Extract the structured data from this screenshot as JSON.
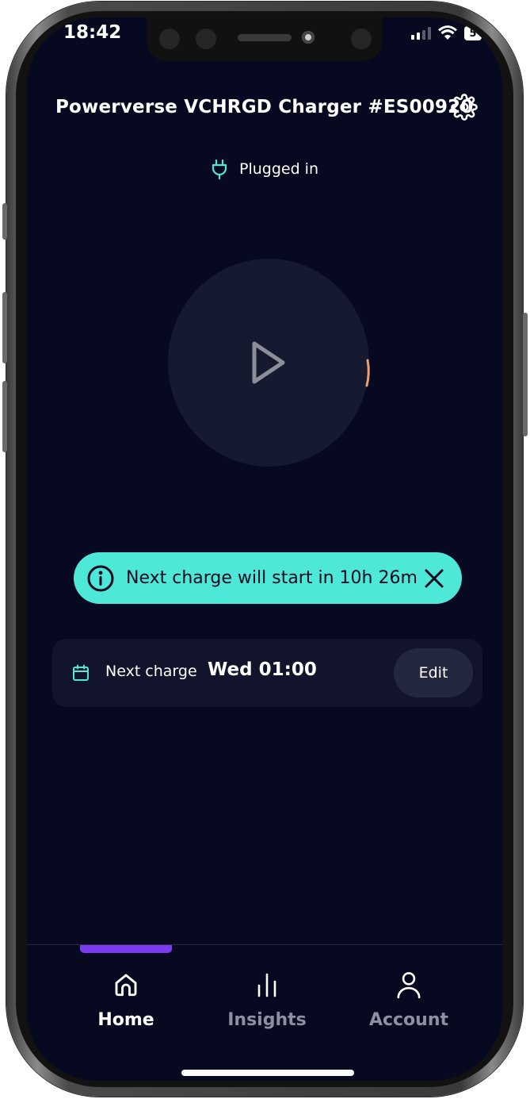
{
  "status_bar": {
    "time": "18:42",
    "battery": "5",
    "icons": [
      "signal-icon",
      "wifi-icon",
      "battery-icon"
    ]
  },
  "header": {
    "title": "Powerverse VCHRGD Charger #ES00920",
    "settings_icon": "gear-icon"
  },
  "charger_status": {
    "label": "Plugged in",
    "icon": "plug-icon",
    "color": "#4ee8d8"
  },
  "control": {
    "icon": "play-icon"
  },
  "banner": {
    "text": "Next charge will start in 10h 26m",
    "icon": "info-icon",
    "close_icon": "close-icon",
    "color": "#4ee8d8"
  },
  "schedule": {
    "label": "Next charge",
    "value": "Wed 01:00",
    "edit_label": "Edit",
    "icon": "calendar-icon"
  },
  "tabs": [
    {
      "label": "Home",
      "icon": "home-icon",
      "active": true
    },
    {
      "label": "Insights",
      "icon": "bar-chart-icon",
      "active": false
    },
    {
      "label": "Account",
      "icon": "user-icon",
      "active": false
    }
  ],
  "colors": {
    "background": "#070920",
    "accent": "#4ee8d8",
    "active_tab_indicator": "#7b3cf0",
    "progress_arc": "#f0a070"
  }
}
